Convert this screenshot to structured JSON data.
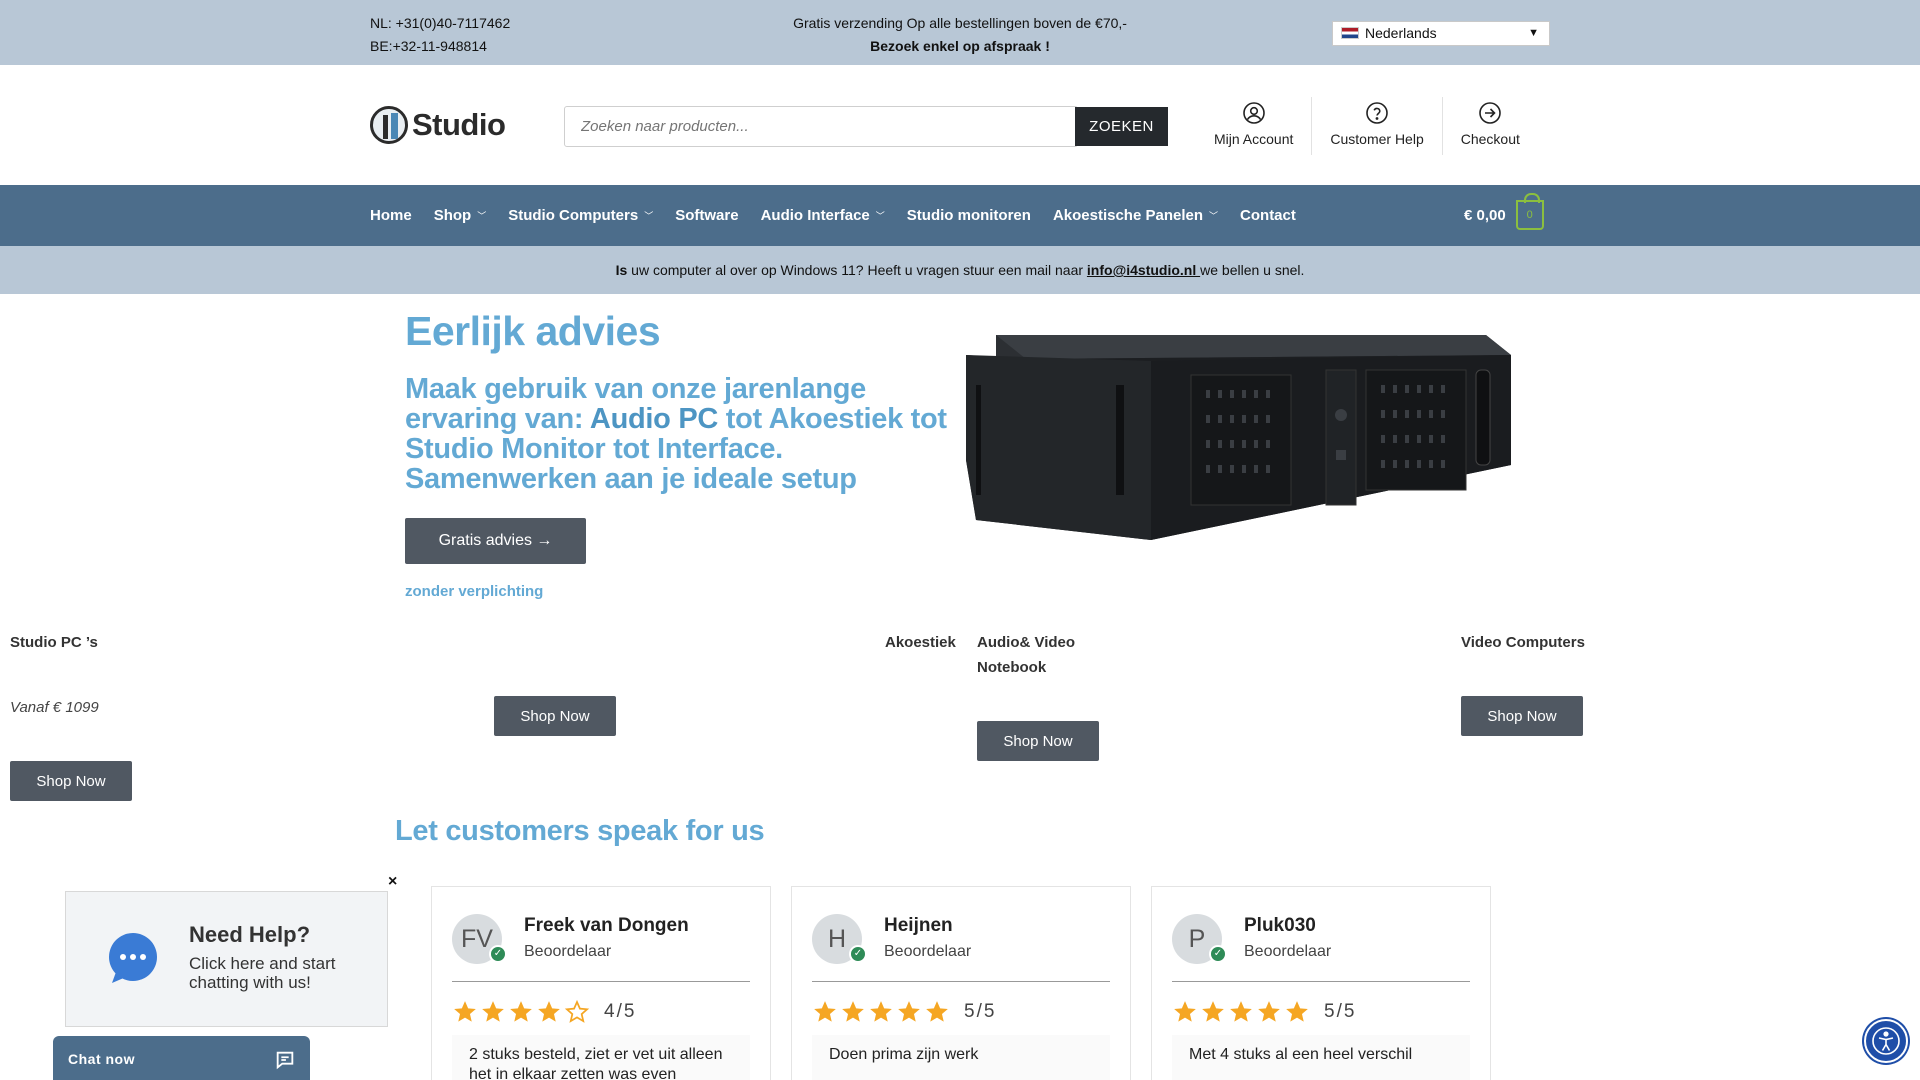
{
  "topbar": {
    "phone_nl": "NL: +31(0)40-7117462",
    "phone_be": "BE:+32-11-948814",
    "shipping": "Gratis verzending Op alle bestellingen boven de €70,-",
    "appointment": "Bezoek enkel op afspraak !",
    "language": "Nederlands"
  },
  "header": {
    "logo_text": "Studio",
    "search_placeholder": "Zoeken naar producten...",
    "search_button": "ZOEKEN",
    "links": [
      {
        "label": "Mijn Account",
        "icon": "user-circle-icon"
      },
      {
        "label": "Customer Help",
        "icon": "question-circle-icon"
      },
      {
        "label": "Checkout",
        "icon": "arrow-right-circle-icon"
      }
    ]
  },
  "nav": {
    "items": [
      {
        "label": "Home",
        "dropdown": false
      },
      {
        "label": "Shop",
        "dropdown": true
      },
      {
        "label": "Studio Computers",
        "dropdown": true
      },
      {
        "label": "Software",
        "dropdown": false
      },
      {
        "label": "Audio Interface",
        "dropdown": true
      },
      {
        "label": "Studio monitoren",
        "dropdown": false
      },
      {
        "label": "Akoestische Panelen",
        "dropdown": true
      },
      {
        "label": "Contact",
        "dropdown": false
      }
    ],
    "cart_total": "€ 0,00",
    "cart_count": "0"
  },
  "notice": {
    "prefix": "Is",
    "text": " uw computer al over op Windows 11? Heeft u vragen stuur een mail naar ",
    "email": "info@i4studio.nl ",
    "suffix": "we bellen u snel."
  },
  "hero": {
    "title": "Eerlijk advies",
    "sub_part1": "Maak gebruik van onze jarenlange ervaring van: ",
    "sub_highlight": "Audio PC",
    "sub_part2": " tot Akoestiek tot Studio Monitor tot Interface. Samenwerken aan je ideale setup",
    "button": "Gratis advies →",
    "note": "zonder verplichting"
  },
  "categories": [
    {
      "label": "Studio PC ’s",
      "price": "Vanaf € 1099",
      "button": "Shop Now"
    },
    {
      "label": "",
      "price": "",
      "button": "Shop Now"
    },
    {
      "label": "Akoestiek",
      "price": "",
      "button": ""
    },
    {
      "label": "Audio& Video Notebook",
      "price": "",
      "button": "Shop Now"
    },
    {
      "label": "Video Computers",
      "price": "",
      "button": "Shop Now"
    }
  ],
  "reviews": {
    "title": "Let customers speak for us",
    "items": [
      {
        "initials": "FV",
        "name": "Freek van Dongen",
        "role": "Beoordelaar",
        "rating": 4,
        "score": "4/5",
        "text": "2 stuks besteld, ziet er vet uit alleen het in elkaar zetten was even"
      },
      {
        "initials": "H",
        "name": "Heijnen",
        "role": "Beoordelaar",
        "rating": 5,
        "score": "5/5",
        "text": "Doen prima zijn werk"
      },
      {
        "initials": "P",
        "name": "Pluk030",
        "role": "Beoordelaar",
        "rating": 5,
        "score": "5/5",
        "text": "Met 4 stuks al een heel verschil"
      }
    ]
  },
  "chat": {
    "title": "Need Help?",
    "text": "Click here and start chatting with us!",
    "close": "×",
    "button": "Chat now"
  },
  "colors": {
    "accent": "#63a9d4",
    "nav_bg": "#4c6d8b",
    "bar_bg": "#b8c7d6",
    "button_bg": "#505862",
    "star": "#f5a623"
  }
}
